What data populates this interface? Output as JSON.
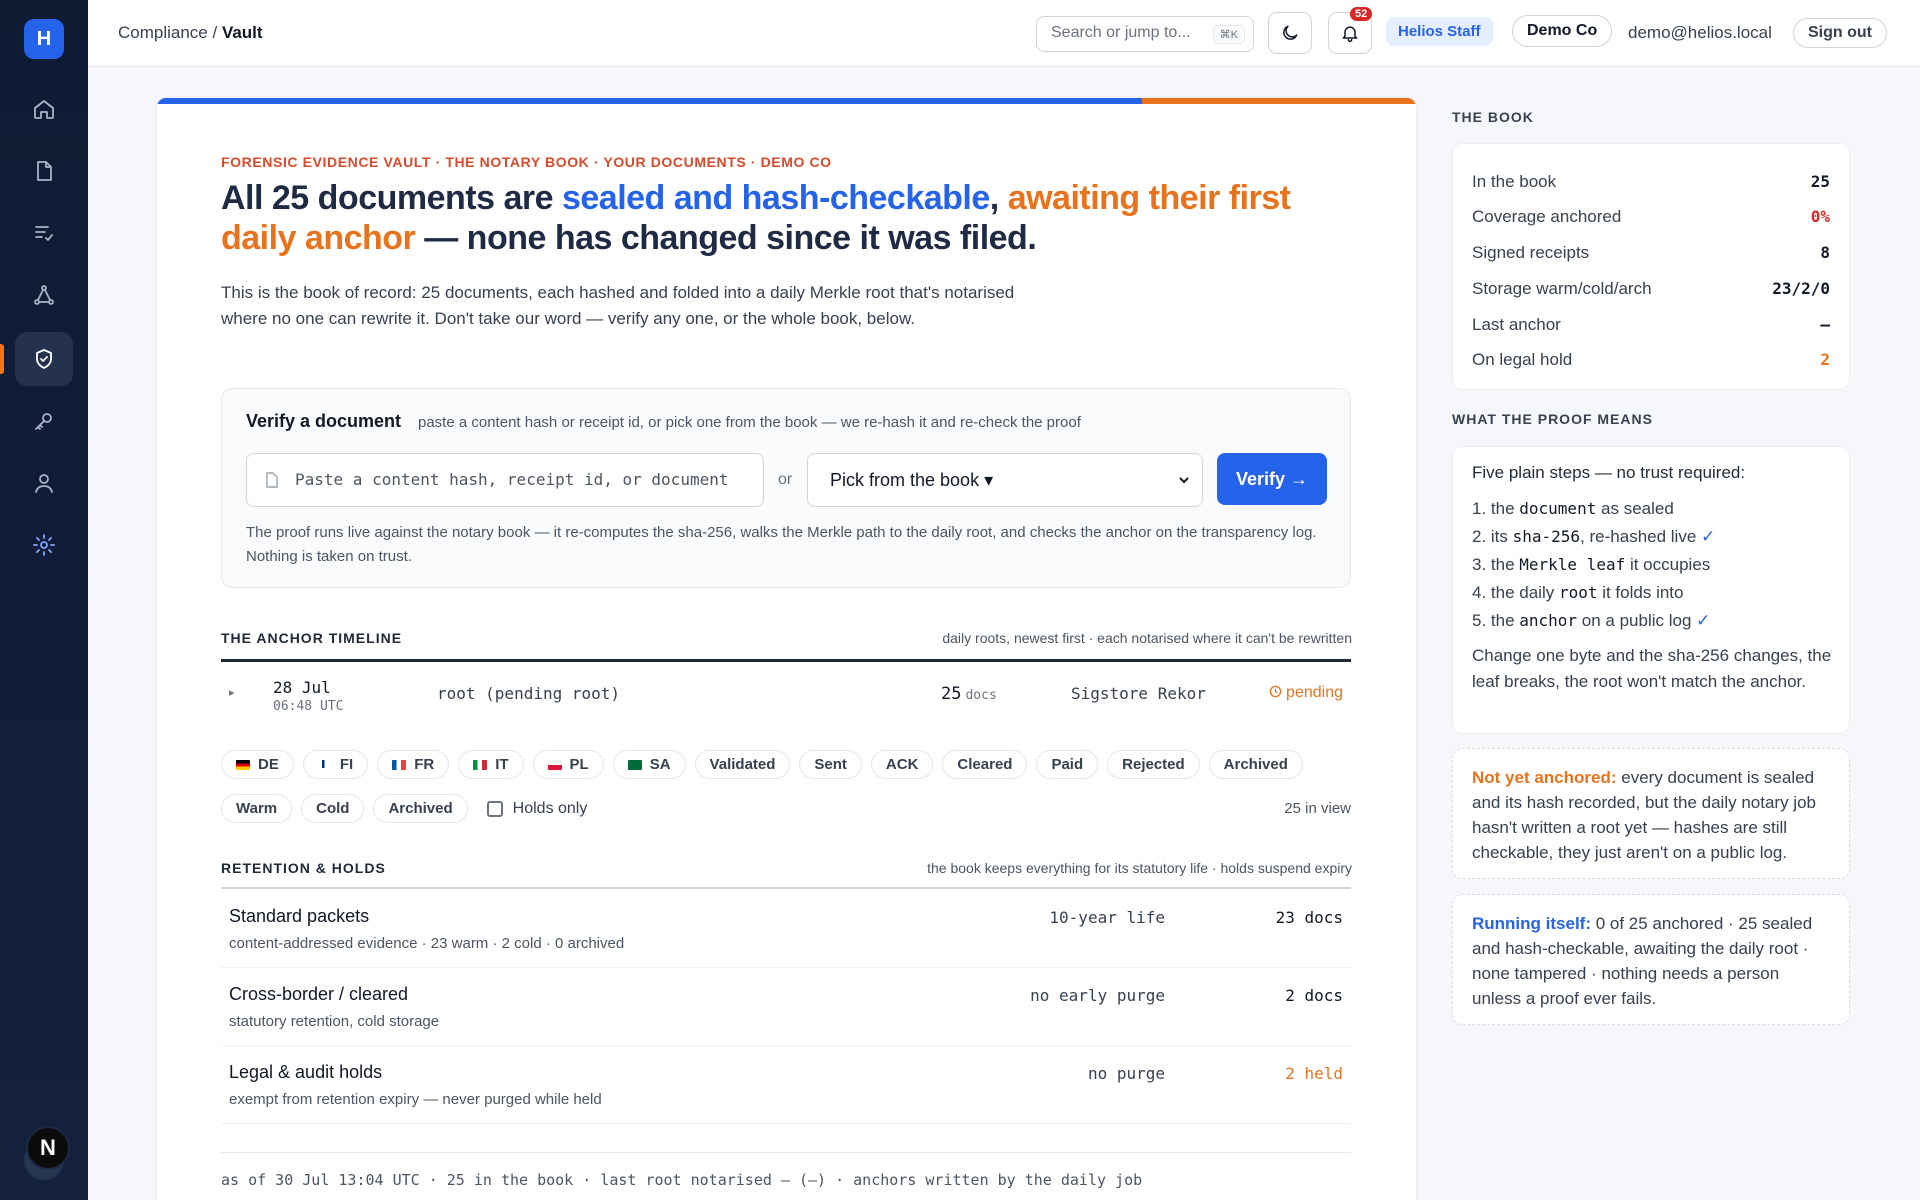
{
  "app": {
    "logo_letter": "H"
  },
  "sidebar": {
    "items": [
      {
        "name": "home-icon"
      },
      {
        "name": "document-icon"
      },
      {
        "name": "list-check-icon"
      },
      {
        "name": "network-icon"
      },
      {
        "name": "shield-check-icon",
        "active": true
      },
      {
        "name": "key-icon"
      },
      {
        "name": "user-icon"
      },
      {
        "name": "gear-icon"
      }
    ],
    "user_initial": "N"
  },
  "header": {
    "breadcrumb_parent": "Compliance",
    "breadcrumb_sep": " / ",
    "breadcrumb_current": "Vault",
    "search_placeholder": "Search or jump to...",
    "search_shortcut": "⌘K",
    "notification_count": "52",
    "staff_label": "Helios Staff",
    "org_label": "Demo Co",
    "email": "demo@helios.local",
    "signout_label": "Sign out"
  },
  "main": {
    "eyebrow": "FORENSIC EVIDENCE VAULT · THE NOTARY BOOK · YOUR DOCUMENTS · DEMO CO",
    "headline_a": "All 25 documents are ",
    "headline_b": "sealed and hash-checkable",
    "headline_c": ", ",
    "headline_d": "awaiting their first daily anchor",
    "headline_e": " — none has changed since it was filed.",
    "lede": "This is the book of record: 25 documents, each hashed and folded into a daily Merkle root that's notarised where no one can rewrite it. Don't take our word — verify any one, or the whole book, below.",
    "verify": {
      "title": "Verify a document",
      "hint": "paste a content hash or receipt id, or pick one from the book — we re-hash it and re-check the proof",
      "input_placeholder": "Paste a content hash, receipt id, or document",
      "or_label": "or",
      "picker_label": "Pick from the book ▾",
      "button_label": "Verify →",
      "note": "The proof runs live against the notary book — it re-computes the sha-256, walks the Merkle path to the daily root, and checks the anchor on the transparency log. Nothing is taken on trust."
    },
    "timeline": {
      "title": "THE ANCHOR TIMELINE",
      "hint": "daily roots, newest first · each notarised where it can't be rewritten",
      "rows": [
        {
          "expander": "▸",
          "date": "28 Jul",
          "time": "06:48 UTC",
          "root": "root (pending root)",
          "docs": "25",
          "docs_unit": "docs",
          "log": "Sigstore Rekor",
          "status": "pending"
        }
      ]
    },
    "filters": {
      "countries": [
        {
          "code": "DE",
          "colors": [
            "#000000",
            "#dd0000",
            "#ffce00"
          ]
        },
        {
          "code": "FI",
          "colors": [
            "#ffffff",
            "#003580",
            "#ffffff"
          ]
        },
        {
          "code": "FR",
          "colors": [
            "#0055a4",
            "#ffffff",
            "#ef4135"
          ]
        },
        {
          "code": "IT",
          "colors": [
            "#009246",
            "#ffffff",
            "#ce2b37"
          ]
        },
        {
          "code": "PL",
          "colors": [
            "#ffffff",
            "#dc143c",
            "#dc143c"
          ]
        },
        {
          "code": "SA",
          "colors": [
            "#006c35",
            "#006c35",
            "#006c35"
          ]
        }
      ],
      "statuses": [
        "Validated",
        "Sent",
        "ACK",
        "Cleared",
        "Paid",
        "Rejected",
        "Archived"
      ],
      "tiers": [
        "Warm",
        "Cold",
        "Archived"
      ],
      "holds_only_label": "Holds only",
      "in_view": "25 in view"
    },
    "retention": {
      "title": "RETENTION & HOLDS",
      "hint": "the book keeps everything for its statutory life · holds suspend expiry",
      "rows": [
        {
          "name": "Standard packets",
          "sub": "content-addressed evidence · 23 warm · 2 cold · 0 archived",
          "life": "10-year life",
          "count": "23 docs"
        },
        {
          "name": "Cross-border / cleared",
          "sub": "statutory retention, cold storage",
          "life": "no early purge",
          "count": "2 docs"
        },
        {
          "name": "Legal & audit holds",
          "sub": "exempt from retention expiry — never purged while held",
          "life": "no purge",
          "count": "2 held"
        }
      ]
    },
    "footer_note": "as of 30 Jul 13:04 UTC · 25 in the book · last root notarised — (—) · anchors written by the daily job"
  },
  "right": {
    "book_title": "THE BOOK",
    "stats": [
      {
        "label": "In the book",
        "value": "25"
      },
      {
        "label": "Coverage anchored",
        "value": "0%"
      },
      {
        "label": "Signed receipts",
        "value": "8"
      },
      {
        "label": "Storage warm/cold/arch",
        "value": "23/2/0"
      },
      {
        "label": "Last anchor",
        "value": "—"
      },
      {
        "label": "On legal hold",
        "value": "2"
      }
    ],
    "proof_title": "WHAT THE PROOF MEANS",
    "proof_intro": "Five plain steps — no trust required:",
    "proof_steps": [
      {
        "pre": "1. the ",
        "code": "document",
        "post": " as sealed",
        "tick": ""
      },
      {
        "pre": "2. its ",
        "code": "sha-256",
        "post": ", re-hashed live ",
        "tick": "✓"
      },
      {
        "pre": "3. the ",
        "code": "Merkle leaf",
        "post": " it occupies",
        "tick": ""
      },
      {
        "pre": "4. the daily ",
        "code": "root",
        "post": " it folds into",
        "tick": ""
      },
      {
        "pre": "5. the ",
        "code": "anchor",
        "post": " on a public log ",
        "tick": "✓"
      }
    ],
    "proof_foot": "Change one byte and the sha-256 changes, the leaf breaks, the root won't match the anchor.",
    "notice_key": "Not yet anchored:",
    "notice_text": " every document is sealed and its hash recorded, but the daily notary job hasn't written a root yet — hashes are still checkable, they just aren't on a public log.",
    "running_key": "Running itself:",
    "running_text": " 0 of 25 anchored · 25 sealed and hash-checkable, awaiting the daily root · none tampered · nothing needs a person unless a proof ever fails."
  },
  "colors": {
    "accent_blue": "#2563eb",
    "accent_orange": "#e8731c",
    "eyebrow_red": "#dc4a2a",
    "sidebar_bg": "#0f1a33"
  }
}
